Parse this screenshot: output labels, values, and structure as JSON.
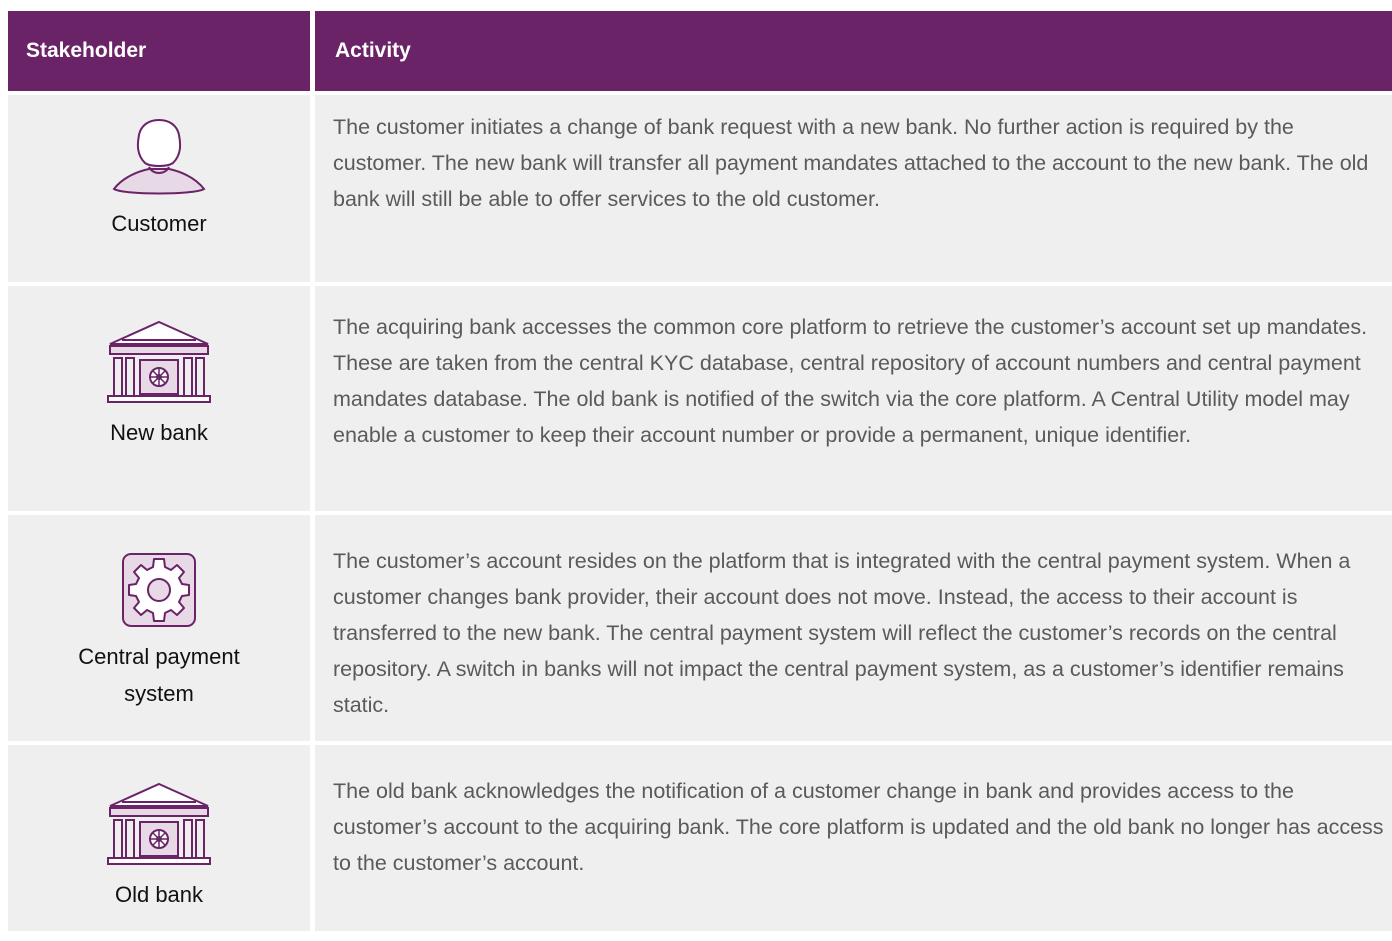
{
  "header": {
    "stakeholder": "Stakeholder",
    "activity": "Activity"
  },
  "rows": [
    {
      "stakeholder": "Customer",
      "icon": "person-icon",
      "activity": "The customer initiates a change of bank request with a new bank. No further action is required by the customer. The new bank will transfer all payment mandates attached to the account to the new bank. The old bank will still be able to offer services to the old customer."
    },
    {
      "stakeholder": "New bank",
      "icon": "bank-icon",
      "activity": "The acquiring bank accesses the common core platform to retrieve the customer’s account set up mandates. These are taken from the central KYC database, central repository of account numbers and central payment mandates database. The old bank is notified of the switch via the core platform. A Central Utility model may enable a customer to keep their account number or provide a permanent, unique identifier."
    },
    {
      "stakeholder": "Central payment system",
      "icon": "gear-icon",
      "activity": "The customer’s account resides on the platform that is integrated with the central payment system. When a customer changes bank provider, their account does not move. Instead, the access to their account is transferred to the new bank. The central payment system will reflect the customer’s records on the central repository. A switch in banks will not impact the central payment system, as a customer’s identifier remains static."
    },
    {
      "stakeholder": "Old bank",
      "icon": "bank-icon",
      "activity": "The old bank acknowledges the notification of a customer change in bank and provides access to the customer’s account to the acquiring bank. The core platform is updated and the old bank no longer has access to the customer’s account."
    }
  ],
  "colors": {
    "header_bg": "#6b2368",
    "row_bg": "#efefef",
    "icon_stroke": "#6b2368",
    "icon_fill": "#e8d9e7"
  }
}
